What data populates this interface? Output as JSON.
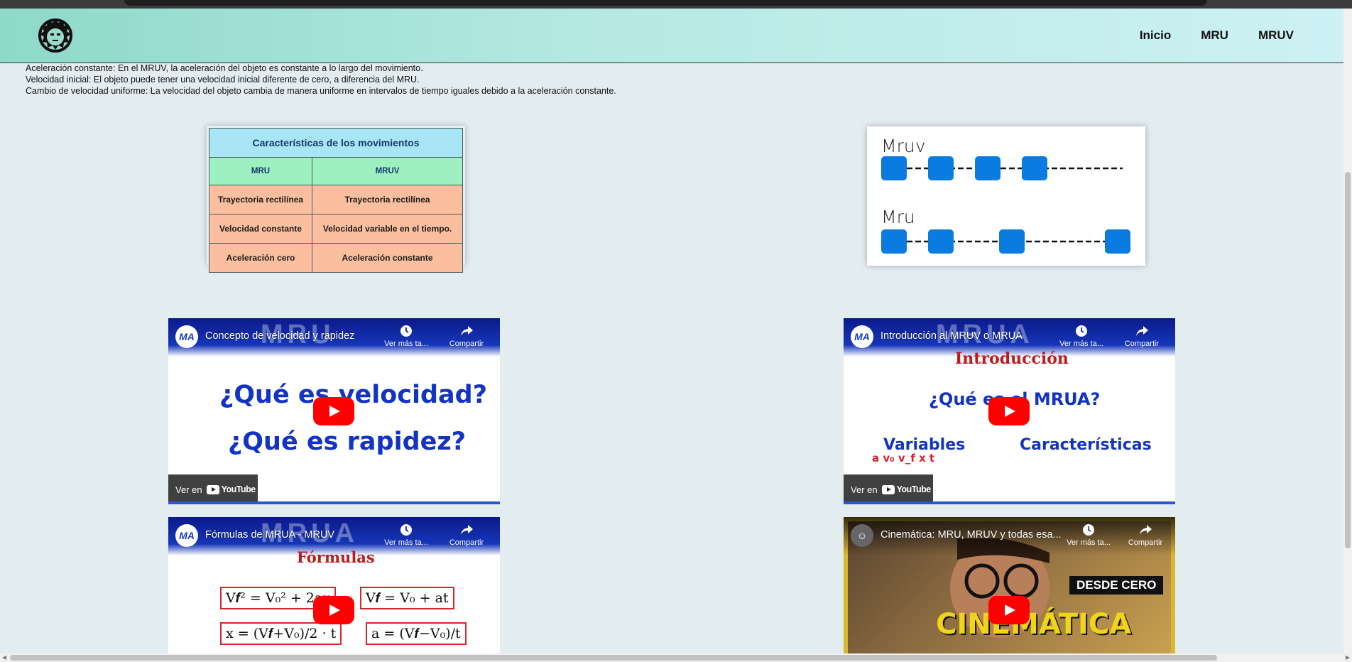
{
  "nav": {
    "items": [
      {
        "label": "Inicio"
      },
      {
        "label": "MRU"
      },
      {
        "label": "MRUV"
      }
    ]
  },
  "content": {
    "lines": [
      "Aceleración constante: En el MRUV, la aceleración del objeto es constante a lo largo del movimiento.",
      "Velocidad inicial: El objeto puede tener una velocidad inicial diferente de cero, a diferencia del MRU.",
      "Cambio de velocidad uniforme: La velocidad del objeto cambia de manera uniforme en intervalos de tiempo iguales debido a la aceleración constante."
    ]
  },
  "comparison_table": {
    "title": "Características de los movimientos",
    "headers": [
      "MRU",
      "MRUV"
    ],
    "rows": [
      [
        "Trayectoria rectilínea",
        "Trayectoria rectilínea"
      ],
      [
        "Velocidad constante",
        "Velocidad variable en el tiempo."
      ],
      [
        "Aceleración cero",
        "Aceleración constante"
      ]
    ]
  },
  "diagram": {
    "label_top": "Mruv",
    "label_bottom": "Mru"
  },
  "videos": [
    {
      "title": "Concepto de velocidad y rapidez",
      "watermark": "MRU",
      "avatar": "MA",
      "line1": "¿Qué es velocidad?",
      "line2": "¿Qué es rapidez?",
      "watch_later": "Ver más ta...",
      "share": "Compartir",
      "watch_on": "Ver en",
      "youtube": "YouTube"
    },
    {
      "title": "Introducción al MRUV o MRUA",
      "watermark": "MRUA",
      "avatar": "MA",
      "heading": "Introducción",
      "question": "¿Qué es el MRUA?",
      "left_label": "Variables",
      "right_label": "Características",
      "vars": "a  v₀  v_f  x  t",
      "watch_later": "Ver más ta...",
      "share": "Compartir",
      "watch_on": "Ver en",
      "youtube": "YouTube"
    },
    {
      "title": "Fórmulas de MRUA - MRUV",
      "watermark": "MRUA",
      "avatar": "MA",
      "heading": "Fórmulas",
      "f1": "V𝒇² = V₀² + 2ax",
      "f2": "V𝒇 = V₀ + at",
      "f3": "x = (V𝒇+V₀)/2 · t",
      "f4": "a = (V𝒇−V₀)/t",
      "watch_later": "Ver más ta...",
      "share": "Compartir"
    },
    {
      "title": "Cinemática: MRU, MRUV y todas esa...",
      "badge": "DESDE CERO",
      "big": "CINEMÁTICA",
      "watch_later": "Ver más ta...",
      "share": "Compartir"
    }
  ]
}
